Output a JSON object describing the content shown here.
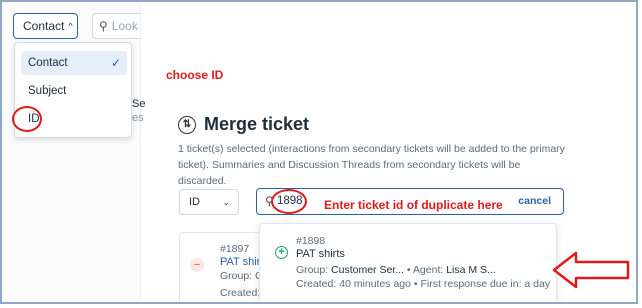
{
  "filter": {
    "label": "Contact",
    "search_placeholder": "Look f"
  },
  "menu": {
    "items": [
      {
        "label": "Contact",
        "selected": true
      },
      {
        "label": "Subject",
        "selected": false
      },
      {
        "label": "ID",
        "selected": false
      }
    ]
  },
  "background_list": {
    "fragment_1": "Se",
    "fragment_2": "es"
  },
  "annotations": {
    "choose_id": "choose ID",
    "enter_ticket": "Enter ticket id of duplicate here"
  },
  "merge": {
    "title": "Merge ticket",
    "description": "1 ticket(s) selected (interactions from secondary tickets will be added to the primary ticket). Summaries and Discussion Threads from secondary tickets will be discarded.",
    "search_by": "ID",
    "search_value": "1898",
    "cancel_label": "cancel"
  },
  "primary_ticket": {
    "id": "#1897",
    "subject": "PAT shir",
    "group_label": "Group: C",
    "created_label": "Created:"
  },
  "result_ticket": {
    "id": "#1898",
    "subject": "PAT shirts",
    "group_label": "Group:",
    "group_value": "Customer Ser...",
    "agent_label": "Agent:",
    "agent_value": "Lisa M S...",
    "created_label": "Created: 40 minutes ago",
    "first_response": "First response due in: a day"
  },
  "colors": {
    "accent": "#2b5eab",
    "annotation": "#e01b1b",
    "add": "#1aa86a"
  }
}
